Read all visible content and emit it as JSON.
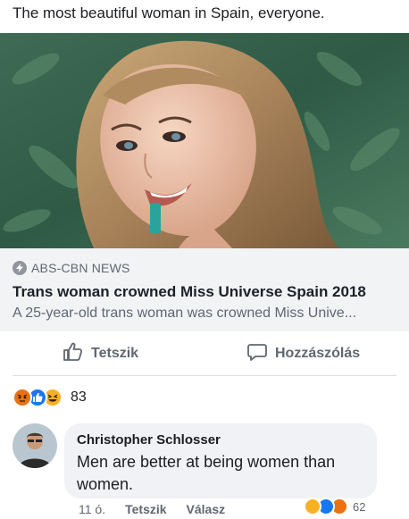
{
  "post": {
    "text": "The most beautiful woman in Spain, everyone."
  },
  "link": {
    "source": "ABS-CBN NEWS",
    "title": "Trans woman crowned Miss Universe Spain 2018",
    "description": "A 25-year-old trans woman was crowned Miss Unive..."
  },
  "actions": {
    "like_label": "Tetszik",
    "comment_label": "Hozzászólás"
  },
  "reactions": {
    "count": "83",
    "icons": [
      "angry-reaction-icon",
      "like-reaction-icon",
      "haha-reaction-icon"
    ]
  },
  "comment": {
    "author": "Christopher Schlosser",
    "text": "Men are better at being women than women.",
    "time": "11 ó.",
    "like_label": "Tetszik",
    "reply_label": "Válasz",
    "reactions_count": "62",
    "reaction_icons": [
      "haha-reaction-icon",
      "like-reaction-icon",
      "angry-reaction-icon"
    ]
  },
  "colors": {
    "link_bg": "#f2f3f5",
    "muted_text": "#606770",
    "comment_bg": "#f0f2f5",
    "like_blue": "#1877f2",
    "haha_yellow": "#f7b125",
    "angry_orange": "#e9710f"
  }
}
